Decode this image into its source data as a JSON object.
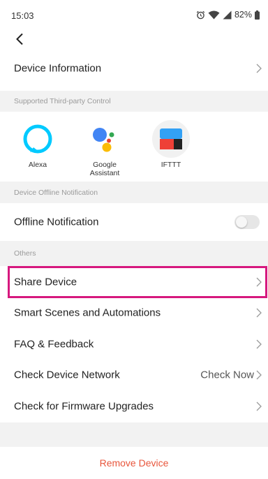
{
  "status_bar": {
    "time": "15:03",
    "battery_percent": "82%",
    "icons": [
      "alarm-icon",
      "wifi-icon",
      "signal-icon",
      "battery-icon"
    ]
  },
  "nav": {
    "back_icon": "chevron-left-icon"
  },
  "device_information": {
    "label": "Device Information"
  },
  "third_party": {
    "section_title": "Supported Third-party Control",
    "items": [
      {
        "label": "Alexa",
        "icon": "alexa-icon",
        "color": "#00CAFF"
      },
      {
        "label": "Google Assistant",
        "icon": "google-assistant-icon",
        "color": "#4285F4"
      },
      {
        "label": "IFTTT",
        "icon": "ifttt-icon",
        "color": "#33A1F5"
      }
    ]
  },
  "offline": {
    "section_title": "Device Offline Notification",
    "label": "Offline Notification",
    "enabled": false
  },
  "others": {
    "section_title": "Others",
    "items": [
      {
        "label": "Share Device"
      },
      {
        "label": "Smart Scenes and Automations"
      },
      {
        "label": "FAQ & Feedback"
      },
      {
        "label": "Check Device Network",
        "value": "Check Now"
      },
      {
        "label": "Check for Firmware Upgrades"
      }
    ]
  },
  "remove": {
    "label": "Remove Device",
    "color": "#E8563C"
  },
  "colors": {
    "highlight": "#D6187E",
    "section_bg": "#F2F2F2"
  }
}
